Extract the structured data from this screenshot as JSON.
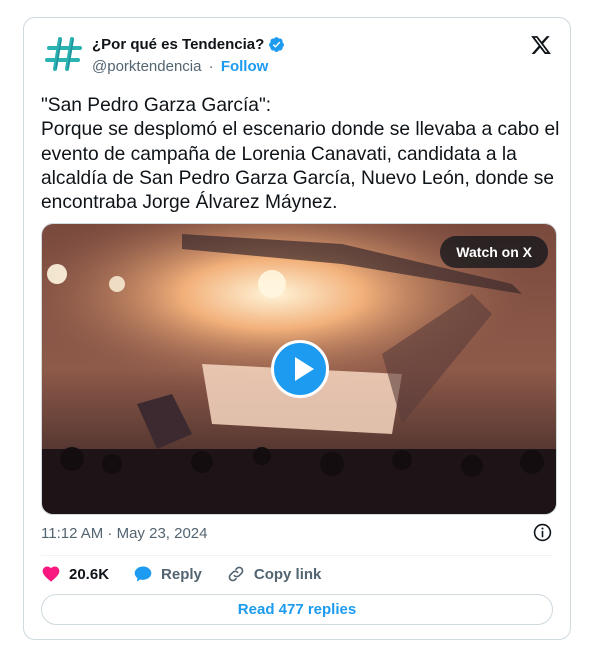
{
  "author": {
    "name": "¿Por qué es Tendencia?",
    "handle": "@porktendencia",
    "separator": "·",
    "follow_label": "Follow"
  },
  "tweet": {
    "text": "\"San Pedro Garza García\":\nPorque se desplomó el escenario donde se llevaba a cabo el evento de campaña de Lorenia Canavati, candidata a la alcaldía de San Pedro Garza García, Nuevo León, donde se encontraba Jorge Álvarez Máynez.",
    "timestamp": "11:12 AM · May 23, 2024"
  },
  "media": {
    "watch_label": "Watch on X"
  },
  "actions": {
    "likes": "20.6K",
    "reply_label": "Reply",
    "copy_label": "Copy link"
  },
  "replies_button": "Read 477 replies",
  "colors": {
    "accent": "#1d9bf0",
    "like": "#f91880",
    "muted": "#536471"
  }
}
